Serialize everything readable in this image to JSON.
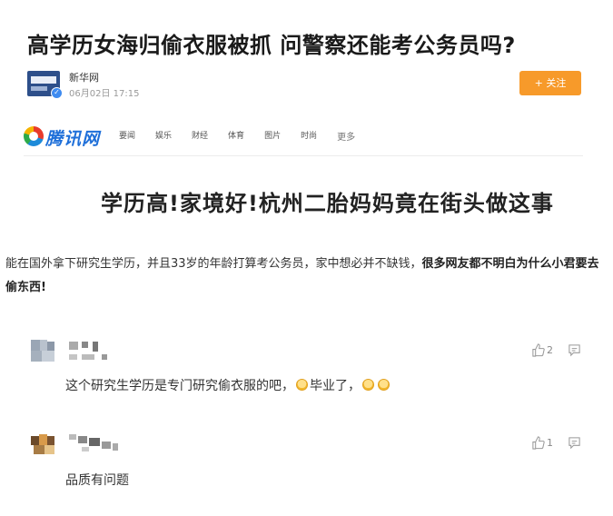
{
  "article": {
    "headline": "高学历女海归偷衣服被抓 问警察还能考公务员吗?",
    "author": {
      "name": "新华网",
      "time": "06月02日 17:15",
      "follow_label": "+ 关注"
    }
  },
  "qq_header": {
    "logo_text": "腾讯网",
    "nav": [
      "要闻",
      "娱乐",
      "财经",
      "体育",
      "图片",
      "时尚",
      "更多"
    ]
  },
  "banner": {
    "text": "学历高!家境好!杭州二胎妈妈竟在街头做这事"
  },
  "paragraph": {
    "normal": "能在国外拿下研究生学历，并且33岁的年龄打算考公务员，家中想必并不缺钱，",
    "bold": "很多网友都不明白为什么小君要去偷东西!"
  },
  "comments": [
    {
      "text_a": "这个研究生学历是专门研究偷衣服的吧，",
      "text_b": "毕业了，",
      "likes": "2",
      "like_icon": "thumbs-up-icon",
      "reply_icon": "comment-icon"
    },
    {
      "text_a": "品质有问题",
      "text_b": "",
      "likes": "1",
      "like_icon": "thumbs-up-icon",
      "reply_icon": "comment-icon"
    }
  ],
  "colors": {
    "follow_button": "#f79a2a",
    "qq_logo": "#1e6fd9"
  }
}
